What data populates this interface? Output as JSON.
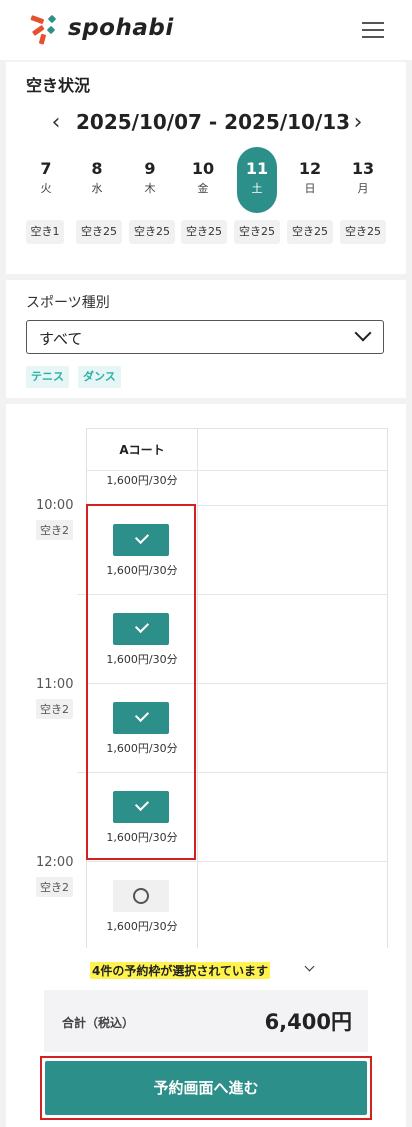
{
  "header": {
    "brand": "spohabi"
  },
  "availability": {
    "title": "空き状況",
    "range": "2025/10/07 - 2025/10/13",
    "days": [
      {
        "num": "7",
        "weekday": "火",
        "avail": "空き1"
      },
      {
        "num": "8",
        "weekday": "水",
        "avail": "空き25"
      },
      {
        "num": "9",
        "weekday": "木",
        "avail": "空き25"
      },
      {
        "num": "10",
        "weekday": "金",
        "avail": "空き25"
      },
      {
        "num": "11",
        "weekday": "土",
        "avail": "空き25"
      },
      {
        "num": "12",
        "weekday": "日",
        "avail": "空き25"
      },
      {
        "num": "13",
        "weekday": "月",
        "avail": "空き25"
      }
    ]
  },
  "sport": {
    "label": "スポーツ種別",
    "selected": "すべて",
    "tags": [
      "テニス",
      "ダンス"
    ]
  },
  "schedule": {
    "court": "Aコート",
    "top_price": "1,600円/30分",
    "times": [
      {
        "time": "10:00",
        "avail": "空き2"
      },
      {
        "time": "11:00",
        "avail": "空き2"
      },
      {
        "time": "12:00",
        "avail": "空き2"
      }
    ],
    "slots": [
      {
        "price": "1,600円/30分",
        "state": "selected"
      },
      {
        "price": "1,600円/30分",
        "state": "selected"
      },
      {
        "price": "1,600円/30分",
        "state": "selected"
      },
      {
        "price": "1,600円/30分",
        "state": "selected"
      },
      {
        "price": "1,600円/30分",
        "state": "open"
      }
    ]
  },
  "footer": {
    "notice": "4件の予約枠が選択されています",
    "total_label": "合計（税込）",
    "total_value": "6,400円",
    "proceed_label": "予約画面へ進む"
  },
  "colors": {
    "accent": "#2d8f89",
    "highlight": "#fff44d",
    "outline": "#d32020"
  }
}
